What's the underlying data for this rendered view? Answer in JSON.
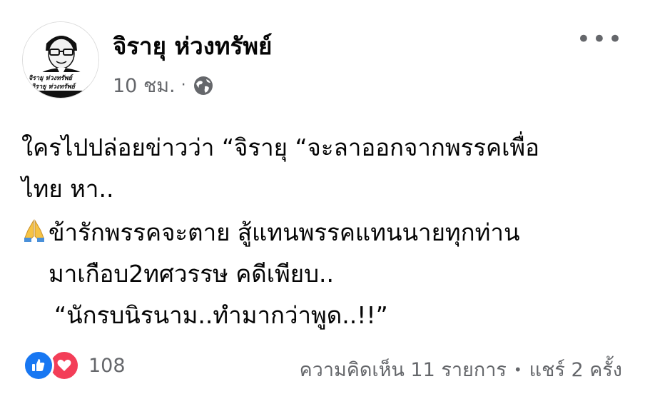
{
  "post": {
    "author": "จิรายุ ห่วงทรัพย์",
    "timestamp": "10 ชม.",
    "separator": "·",
    "privacy_icon": "globe-icon",
    "avatar_caption_line1": "จิรายุ ห่วงทรัพย์",
    "avatar_caption_line2": "จิรายุ ห่วงทรัพย์",
    "more_icon": "more-options-icon",
    "more_label": "•••"
  },
  "content": {
    "line1": "ใครไปปล่อยข่าวว่า “จิรายุ “จะลาออกจากพรรคเพื่อ",
    "line2": "ไทย หา..",
    "line3_emoji": "folded-hands-icon",
    "line3": "ข้ารักพรรคจะตาย สู้แทนพรรคแทนนายทุกท่าน",
    "line4": "มาเกือบ2ทศวรรษ คดีเพียบ..",
    "line5": "“นักรบนิรนาม..ทำมากว่าพูด..!!”"
  },
  "footer": {
    "reaction_icons": [
      "like-icon",
      "love-icon"
    ],
    "reaction_count": "108",
    "comments": "ความคิดเห็น 11 รายการ",
    "bullet": "•",
    "shares": "แชร์ 2 ครั้ง"
  },
  "colors": {
    "text": "#050505",
    "secondary": "#65676b",
    "like": "#1877f2",
    "love": "#f33e58"
  }
}
